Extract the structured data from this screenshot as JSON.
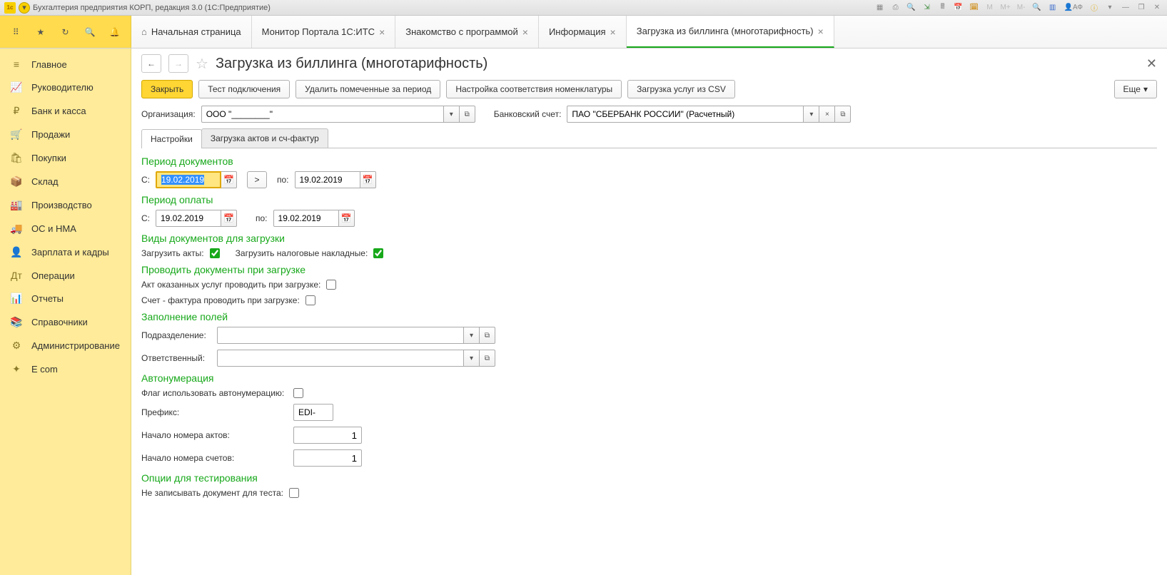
{
  "title_bar": {
    "app_title": "Бухгалтерия предприятия КОРП, редакция 3.0  (1С:Предприятие)",
    "user": "АФ"
  },
  "main_tabs": [
    {
      "label": "Начальная страница",
      "closeable": false,
      "home": true
    },
    {
      "label": "Монитор Портала 1С:ИТС",
      "closeable": true
    },
    {
      "label": "Знакомство с программой",
      "closeable": true
    },
    {
      "label": "Информация",
      "closeable": true
    },
    {
      "label": "Загрузка из биллинга (многотарифность)",
      "closeable": true,
      "active": true
    }
  ],
  "sidebar": {
    "items": [
      {
        "label": "Главное",
        "icon": "≡"
      },
      {
        "label": "Руководителю",
        "icon": "📈"
      },
      {
        "label": "Банк и касса",
        "icon": "₽"
      },
      {
        "label": "Продажи",
        "icon": "🛒"
      },
      {
        "label": "Покупки",
        "icon": "🛍"
      },
      {
        "label": "Склад",
        "icon": "📦"
      },
      {
        "label": "Производство",
        "icon": "🏭"
      },
      {
        "label": "ОС и НМА",
        "icon": "🚚"
      },
      {
        "label": "Зарплата и кадры",
        "icon": "👤"
      },
      {
        "label": "Операции",
        "icon": "Дт"
      },
      {
        "label": "Отчеты",
        "icon": "📊"
      },
      {
        "label": "Справочники",
        "icon": "📚"
      },
      {
        "label": "Администрирование",
        "icon": "⚙"
      },
      {
        "label": "E com",
        "icon": "✦"
      }
    ]
  },
  "page": {
    "title": "Загрузка из биллинга (многотарифность)",
    "buttons": {
      "close": "Закрыть",
      "test_conn": "Тест подключения",
      "delete_marked": "Удалить помеченные за период",
      "nomen_map": "Настройка соответствия номенклатуры",
      "load_csv": "Загрузка услуг из CSV",
      "more": "Еще"
    },
    "org_label": "Организация:",
    "org_value": "ООО \"________\"",
    "bank_label": "Банковский счет:",
    "bank_value": "ПАО \"СБЕРБАНК РОССИИ\" (Расчетный)",
    "subtabs": {
      "settings": "Настройки",
      "load_acts": "Загрузка актов и сч-фактур"
    },
    "sections": {
      "doc_period": "Период документов",
      "pay_period": "Период оплаты",
      "doc_types": "Виды документов для загрузки",
      "posting": "Проводить документы при загрузке",
      "fill": "Заполнение полей",
      "autonum": "Автонумерация",
      "testing": "Опции для тестирования"
    },
    "labels": {
      "from": "С:",
      "to": "по:",
      "load_acts": "Загрузить акты:",
      "load_tax": "Загрузить налоговые накладные:",
      "post_acts": "Акт оказанных услуг проводить при загрузке:",
      "post_invoice": "Счет - фактура проводить при загрузке:",
      "department": "Подразделение:",
      "responsible": "Ответственный:",
      "autonum_flag": "Флаг использовать автонумерацию:",
      "prefix": "Префикс:",
      "acts_start": "Начало номера актов:",
      "invoice_start": "Начало номера счетов:",
      "no_write": "Не записывать документ для теста:"
    },
    "values": {
      "doc_from": "19.02.2019",
      "doc_to": "19.02.2019",
      "pay_from": "19.02.2019",
      "pay_to": "19.02.2019",
      "load_acts_chk": true,
      "load_tax_chk": true,
      "post_acts_chk": false,
      "post_invoice_chk": false,
      "department": "",
      "responsible": "",
      "autonum_flag": false,
      "prefix": "EDI-",
      "acts_start": "1",
      "invoice_start": "1",
      "no_write": false
    }
  }
}
